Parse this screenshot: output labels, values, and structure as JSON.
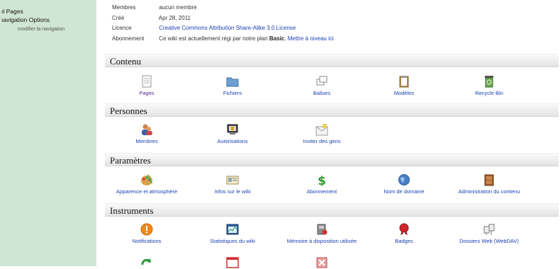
{
  "sidebar": {
    "items": [
      {
        "label": "ıl Pages"
      },
      {
        "label": "ıavigation Options"
      }
    ],
    "sub_link": "modifier la navigation"
  },
  "info": {
    "members_label": "Membres",
    "members_value": "aucun membre",
    "created_label": "Créé",
    "created_value": "Apr 28, 2011",
    "license_label": "Licence",
    "license_value": "Creative Commons Attribution Share-Alike 3.0 License",
    "subscription_label": "Abonnement",
    "subscription_text": "Ce wiki est actuellement régi par notre plan",
    "plan_name": "Basic",
    "upgrade_link": "Mettre à niveau ici"
  },
  "sections": {
    "contenu": "Contenu",
    "personnes": "Personnes",
    "parametres": "Paramètres",
    "instruments": "Instruments"
  },
  "tools": {
    "pages": "Pages",
    "fichiers": "Fichiers",
    "balises": "Balises",
    "modeles": "Modèles",
    "recycle": "Recycle Bin",
    "membres": "Membres",
    "autorisations": "Autorisations",
    "inviter": "Inviter des gens",
    "apparence": "Apparence et atmosphère",
    "infos": "Infos sur le wiki",
    "abonnement": "Abonnement",
    "domaine": "Nom de domaine",
    "admin_contenu": "Administration du contenu",
    "notifications": "Notifications",
    "statistiques": "Statistiques du wiki",
    "memoire": "Mémoire à disposition utilisée",
    "badges": "Badges",
    "webdav": "Dossiers Web (WebDAV)"
  },
  "icons": {
    "pages": "document-icon",
    "fichiers": "folder-icon",
    "balises": "tags-icon",
    "modeles": "clipboard-icon",
    "recycle": "recycle-bin-icon",
    "membres": "users-icon",
    "autorisations": "monitor-lock-icon",
    "inviter": "envelope-icon",
    "apparence": "palette-icon",
    "infos": "id-card-icon",
    "abonnement": "dollar-icon",
    "domaine": "globe-icon",
    "admin_contenu": "cabinet-icon",
    "notifications": "alert-icon",
    "statistiques": "chart-window-icon",
    "memoire": "disk-icon",
    "badges": "rosette-icon",
    "webdav": "network-folders-icon"
  },
  "colors": {
    "sidebar_bg": "#cfe6d4",
    "link": "#1a3fb0",
    "visited_link": "#5a2a8a"
  }
}
